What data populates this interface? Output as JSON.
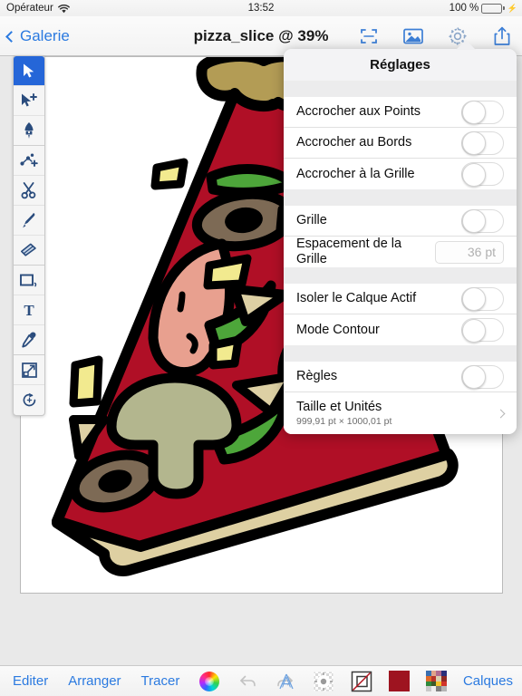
{
  "statusbar": {
    "carrier": "Opérateur",
    "wifi_icon": "wifi-icon",
    "time": "13:52",
    "battery_percent": "100 %",
    "battery_level": 100,
    "charging_icon": "bolt-icon"
  },
  "navbar": {
    "back_label": "Galerie",
    "back_icon": "chevron-left-icon",
    "title": "pizza_slice @ 39%",
    "actions": [
      {
        "name": "fit-to-screen-icon",
        "label": "Ajuster"
      },
      {
        "name": "image-icon",
        "label": "Image"
      },
      {
        "name": "gear-icon",
        "label": "Réglages"
      },
      {
        "name": "share-icon",
        "label": "Partager"
      }
    ]
  },
  "tools": [
    {
      "name": "selection-arrow-tool",
      "label": "Sélection",
      "selected": true
    },
    {
      "name": "node-selection-tool",
      "label": "Sélection de nœud",
      "selected": false
    },
    {
      "name": "pen-tool",
      "label": "Plume",
      "selected": false
    },
    {
      "name": "add-node-tool",
      "label": "Ajouter un nœud",
      "selected": false
    },
    {
      "name": "scissors-tool",
      "label": "Ciseaux",
      "selected": false
    },
    {
      "name": "paintbrush-tool",
      "label": "Pinceau",
      "selected": false
    },
    {
      "name": "eraser-tool",
      "label": "Gomme",
      "selected": false
    },
    {
      "name": "shape-rectangle-tool",
      "label": "Forme",
      "selected": false
    },
    {
      "name": "text-tool",
      "label": "Texte",
      "selected": false
    },
    {
      "name": "eyedropper-tool",
      "label": "Pipette",
      "selected": false
    },
    {
      "name": "transform-tool",
      "label": "Transformation",
      "selected": false
    },
    {
      "name": "rotate-tool",
      "label": "Rotation",
      "selected": false
    }
  ],
  "settings_popover": {
    "title": "Réglages",
    "groups": [
      {
        "rows": [
          {
            "name": "snap-to-points-row",
            "label": "Accrocher aux Points",
            "control": "switch",
            "value": false
          },
          {
            "name": "snap-to-edges-row",
            "label": "Accrocher au Bords",
            "control": "switch",
            "value": false
          },
          {
            "name": "snap-to-grid-row",
            "label": "Accrocher à la Grille",
            "control": "switch",
            "value": false
          }
        ]
      },
      {
        "rows": [
          {
            "name": "grid-row",
            "label": "Grille",
            "control": "switch",
            "value": false
          },
          {
            "name": "grid-spacing-row",
            "label": "Espacement de la Grille",
            "control": "field",
            "value": "",
            "placeholder": "36 pt"
          }
        ]
      },
      {
        "rows": [
          {
            "name": "isolate-active-layer-row",
            "label": "Isoler le Calque Actif",
            "control": "switch",
            "value": false
          },
          {
            "name": "outline-mode-row",
            "label": "Mode Contour",
            "control": "switch",
            "value": false
          }
        ]
      },
      {
        "rows": [
          {
            "name": "rulers-row",
            "label": "Règles",
            "control": "switch",
            "value": false
          },
          {
            "name": "size-and-units-row",
            "label": "Taille et Unités",
            "sublabel": "999,91 pt × 1000,01 pt",
            "control": "disclosure"
          }
        ]
      }
    ]
  },
  "bottombar": {
    "left_items": [
      {
        "name": "edit-button",
        "label": "Editer"
      },
      {
        "name": "arrange-button",
        "label": "Arranger"
      },
      {
        "name": "trace-button",
        "label": "Tracer"
      }
    ],
    "color_wheel_icon": "color-wheel-icon",
    "undo_icon": "undo-icon",
    "redo_icon": "redo-icon",
    "right_icons": [
      {
        "name": "text-style-icon",
        "label": "Style de texte"
      },
      {
        "name": "effects-icon",
        "label": "Effets"
      },
      {
        "name": "stroke-icon",
        "label": "Contour"
      },
      {
        "name": "fill-color-icon",
        "label": "Remplissage",
        "color": "#9e1420"
      },
      {
        "name": "swatches-icon",
        "label": "Nuancier"
      }
    ],
    "layers_label": "Calques"
  },
  "canvas": {
    "document_name": "pizza_slice",
    "zoom": "39%",
    "artwork": "pizza-slice-illustration",
    "colors": {
      "crust": "#d9c691",
      "crust_top": "#b39c55",
      "sauce": "#b00f26",
      "sauce_dark": "#9e1420",
      "pepperoni": "#e8a08f",
      "olive_ring": "#7d6a55",
      "mushroom": "#b3b68e",
      "pepper_green": "#4da63a",
      "cheese_yellow": "#f2ea8f",
      "onion": "#ddd0a4",
      "outline": "#000000"
    }
  }
}
